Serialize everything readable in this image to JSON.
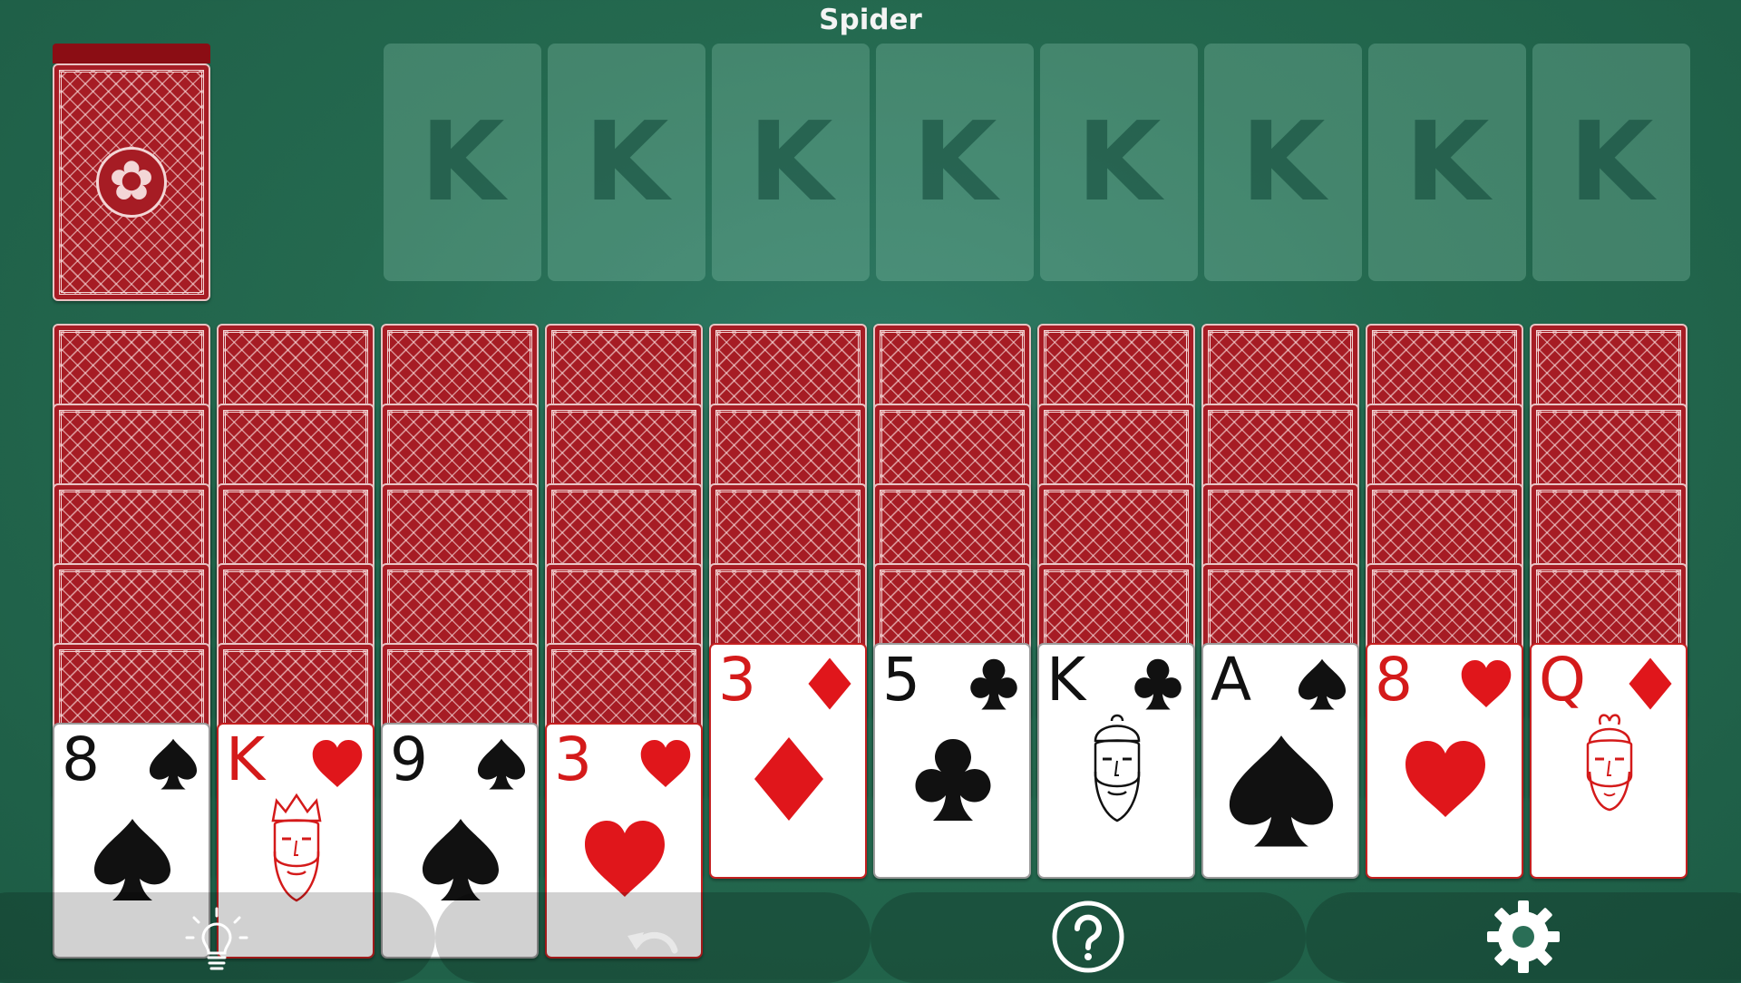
{
  "title": "Spider",
  "foundations": [
    {
      "label": "K"
    },
    {
      "label": "K"
    },
    {
      "label": "K"
    },
    {
      "label": "K"
    },
    {
      "label": "K"
    },
    {
      "label": "K"
    },
    {
      "label": "K"
    },
    {
      "label": "K"
    }
  ],
  "tableau": [
    {
      "face_down": 5,
      "top": {
        "rank": "8",
        "suit": "spade",
        "color": "black"
      }
    },
    {
      "face_down": 5,
      "top": {
        "rank": "K",
        "suit": "heart",
        "color": "red"
      }
    },
    {
      "face_down": 5,
      "top": {
        "rank": "9",
        "suit": "spade",
        "color": "black"
      }
    },
    {
      "face_down": 5,
      "top": {
        "rank": "3",
        "suit": "heart",
        "color": "red"
      }
    },
    {
      "face_down": 4,
      "top": {
        "rank": "3",
        "suit": "diamond",
        "color": "red"
      }
    },
    {
      "face_down": 4,
      "top": {
        "rank": "5",
        "suit": "club",
        "color": "black"
      }
    },
    {
      "face_down": 4,
      "top": {
        "rank": "K",
        "suit": "club",
        "color": "black"
      }
    },
    {
      "face_down": 4,
      "top": {
        "rank": "A",
        "suit": "spade",
        "color": "black"
      }
    },
    {
      "face_down": 4,
      "top": {
        "rank": "8",
        "suit": "heart",
        "color": "red"
      }
    },
    {
      "face_down": 4,
      "top": {
        "rank": "Q",
        "suit": "diamond",
        "color": "red"
      }
    }
  ],
  "toolbar": {
    "hint_icon": "lightbulb-icon",
    "undo_icon": "undo-icon",
    "help_icon": "question-icon",
    "settings_icon": "gear-icon"
  },
  "colors": {
    "felt": "#24694f",
    "card_back": "#a61c24",
    "red_suit": "#e0161b",
    "black_suit": "#111111"
  }
}
